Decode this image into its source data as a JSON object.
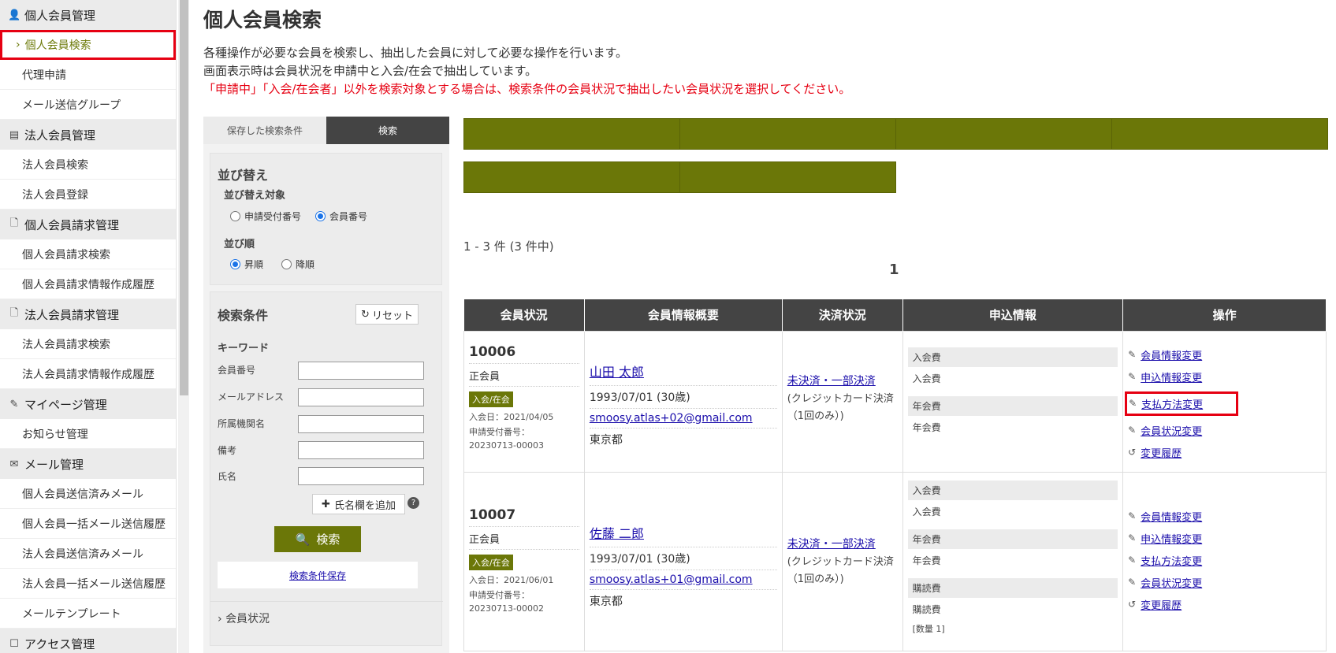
{
  "sidebar": {
    "sections": [
      {
        "icon": "person-icon",
        "glyph": "👤",
        "title": "個人会員管理",
        "items": [
          {
            "label": "個人会員検索",
            "active": true
          },
          {
            "label": "代理申請"
          },
          {
            "label": "メール送信グループ"
          }
        ]
      },
      {
        "icon": "building-icon",
        "glyph": "▤",
        "title": "法人会員管理",
        "items": [
          {
            "label": "法人会員検索"
          },
          {
            "label": "法人会員登録"
          }
        ]
      },
      {
        "icon": "document-icon",
        "glyph": "🗋",
        "title": "個人会員請求管理",
        "items": [
          {
            "label": "個人会員請求検索"
          },
          {
            "label": "個人会員請求情報作成履歴"
          }
        ]
      },
      {
        "icon": "document-icon",
        "glyph": "🗋",
        "title": "法人会員請求管理",
        "items": [
          {
            "label": "法人会員請求検索"
          },
          {
            "label": "法人会員請求情報作成履歴"
          }
        ]
      },
      {
        "icon": "pencil-icon",
        "glyph": "✎",
        "title": "マイページ管理",
        "items": [
          {
            "label": "お知らせ管理"
          }
        ]
      },
      {
        "icon": "mail-icon",
        "glyph": "✉",
        "title": "メール管理",
        "items": [
          {
            "label": "個人会員送信済みメール"
          },
          {
            "label": "個人会員一括メール送信履歴"
          },
          {
            "label": "法人会員送信済みメール"
          },
          {
            "label": "法人会員一括メール送信履歴"
          },
          {
            "label": "メールテンプレート"
          }
        ]
      },
      {
        "icon": "square-icon",
        "glyph": "☐",
        "title": "アクセス管理",
        "items": []
      }
    ]
  },
  "page": {
    "title": "個人会員検索",
    "desc1": "各種操作が必要な会員を検索し、抽出した会員に対して必要な操作を行います。",
    "desc2": "画面表示時は会員状況を申請中と入会/在会で抽出しています。",
    "desc3": "「申請中」「入会/在会者」以外を検索対象とする場合は、検索条件の会員状況で抽出したい会員状況を選択してください。"
  },
  "panel": {
    "tab_saved": "保存した検索条件",
    "tab_search": "検索",
    "sort_title": "並び替え",
    "sort_target": "並び替え対象",
    "sort_opt1": "申請受付番号",
    "sort_opt2": "会員番号",
    "sort_order": "並び順",
    "order_asc": "昇順",
    "order_desc": "降順",
    "cond_title": "検索条件",
    "reset": "リセット",
    "keyword": "キーワード",
    "f_member_no": "会員番号",
    "f_email": "メールアドレス",
    "f_org": "所属機関名",
    "f_note": "備考",
    "f_name": "氏名",
    "add_name": "氏名欄を追加",
    "search_btn": "検索",
    "save_cond": "検索条件保存",
    "member_status": "会員状況"
  },
  "results": {
    "count": "1 - 3 件 (3 件中)",
    "page": "1",
    "headers": [
      "会員状況",
      "会員情報概要",
      "決済状況",
      "申込情報",
      "操作"
    ],
    "rows": [
      {
        "no": "10006",
        "type": "正会員",
        "badge": "入会/在会",
        "joined": "入会日：2021/04/05",
        "app_label": "申請受付番号：",
        "app_no": "20230713-00003",
        "name": "山田 太郎",
        "birth": "1993/07/01 (30歳)",
        "email": "smoosy.atlas+02@gmail.com",
        "pref": "東京都",
        "pay": "未決済・一部決済",
        "pay_sub": "(クレジットカード決済（1回のみ）)",
        "apps": [
          {
            "h": "入会費",
            "v": "入会費"
          },
          {
            "h": "年会費",
            "v": "年会費"
          }
        ]
      },
      {
        "no": "10007",
        "type": "正会員",
        "badge": "入会/在会",
        "joined": "入会日：2021/06/01",
        "app_label": "申請受付番号：",
        "app_no": "20230713-00002",
        "name": "佐藤 二郎",
        "birth": "1993/07/01 (30歳)",
        "email": "smoosy.atlas+01@gmail.com",
        "pref": "東京都",
        "pay": "未決済・一部決済",
        "pay_sub": "(クレジットカード決済（1回のみ）)",
        "apps": [
          {
            "h": "入会費",
            "v": "入会費"
          },
          {
            "h": "年会費",
            "v": "年会費"
          },
          {
            "h": "購読費",
            "v": "購読費",
            "extra": "[数量 1]"
          }
        ]
      }
    ],
    "ops": [
      "会員情報変更",
      "申込情報変更",
      "支払方法変更",
      "会員状況変更",
      "変更履歴"
    ]
  }
}
